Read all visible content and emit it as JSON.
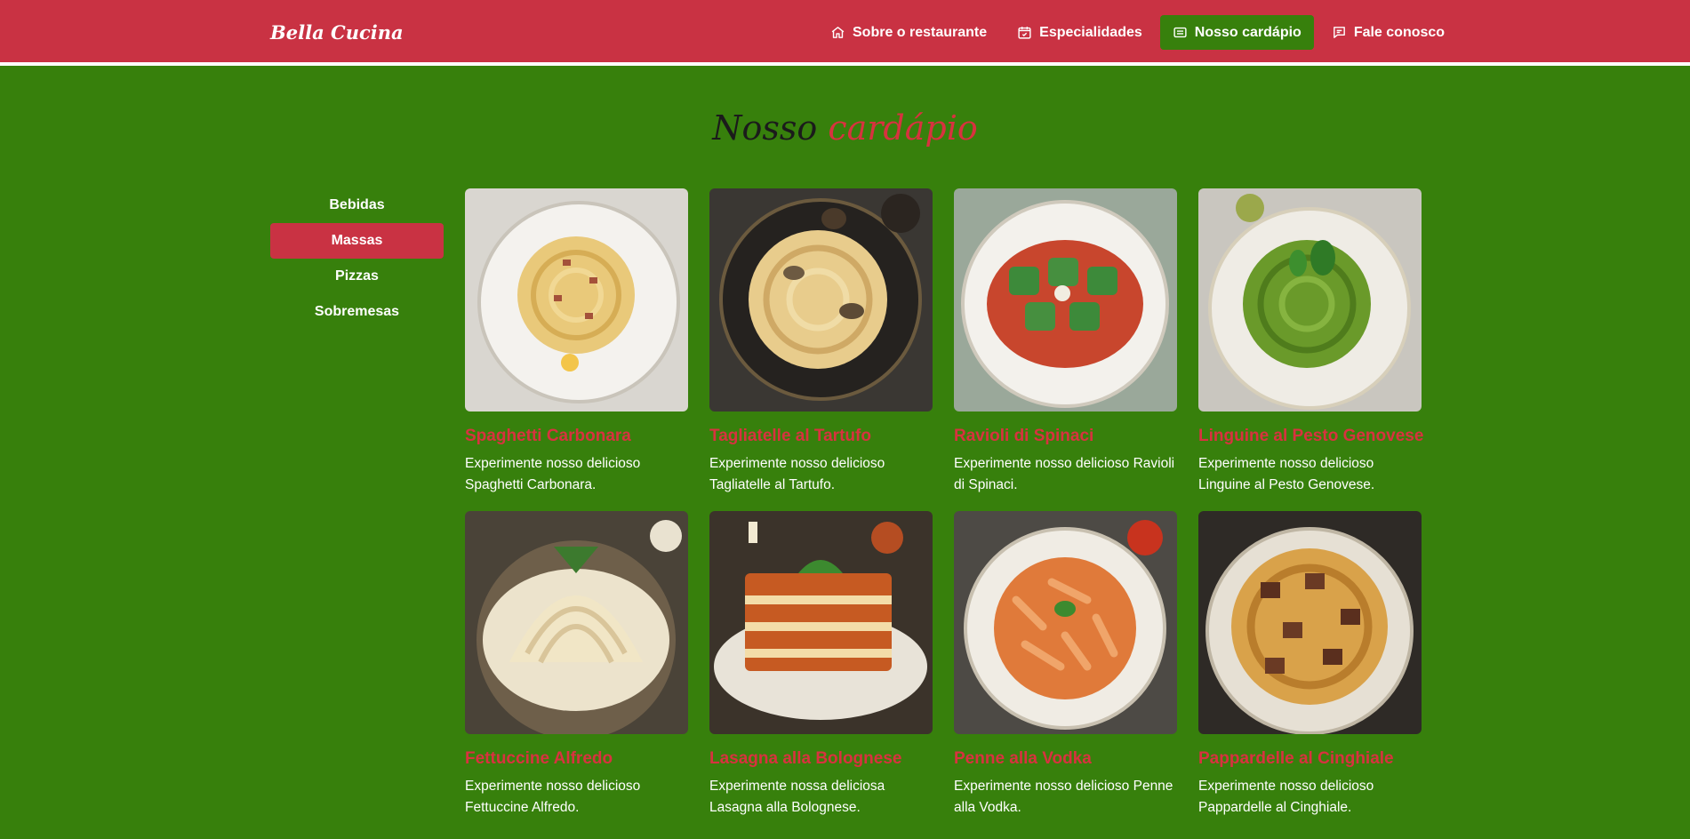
{
  "brand": "Bella Cucina",
  "nav": [
    {
      "label": "Sobre o restaurante",
      "icon": "home-icon"
    },
    {
      "label": "Especialidades",
      "icon": "calendar-check-icon"
    },
    {
      "label": "Nosso cardápio",
      "icon": "menu-list-icon",
      "active": true
    },
    {
      "label": "Fale conosco",
      "icon": "chat-icon"
    }
  ],
  "section": {
    "title_part1": "Nosso",
    "title_part2": "cardápio"
  },
  "categories": [
    {
      "label": "Bebidas"
    },
    {
      "label": "Massas",
      "active": true
    },
    {
      "label": "Pizzas"
    },
    {
      "label": "Sobremesas"
    }
  ],
  "dishes": [
    {
      "title": "Spaghetti Carbonara",
      "description": "Experimente nosso delicioso Spaghetti Carbonara."
    },
    {
      "title": "Tagliatelle al Tartufo",
      "description": "Experimente nosso delicioso Tagliatelle al Tartufo."
    },
    {
      "title": "Ravioli di Spinaci",
      "description": "Experimente nosso delicioso Ravioli di Spinaci."
    },
    {
      "title": "Linguine al Pesto Genovese",
      "description": "Experimente nosso delicioso Linguine al Pesto Genovese."
    },
    {
      "title": "Fettuccine Alfredo",
      "description": "Experimente nosso delicioso Fettuccine Alfredo."
    },
    {
      "title": "Lasagna alla Bolognese",
      "description": "Experimente nossa deliciosa Lasagna alla Bolognese."
    },
    {
      "title": "Penne alla Vodka",
      "description": "Experimente nosso delicioso Penne alla Vodka."
    },
    {
      "title": "Pappardelle al Cinghiale",
      "description": "Experimente nosso delicioso Pappardelle al Cinghiale."
    }
  ],
  "colors": {
    "primary_red": "#c93243",
    "accent_green": "#37800c",
    "title_red": "#d8323f"
  }
}
